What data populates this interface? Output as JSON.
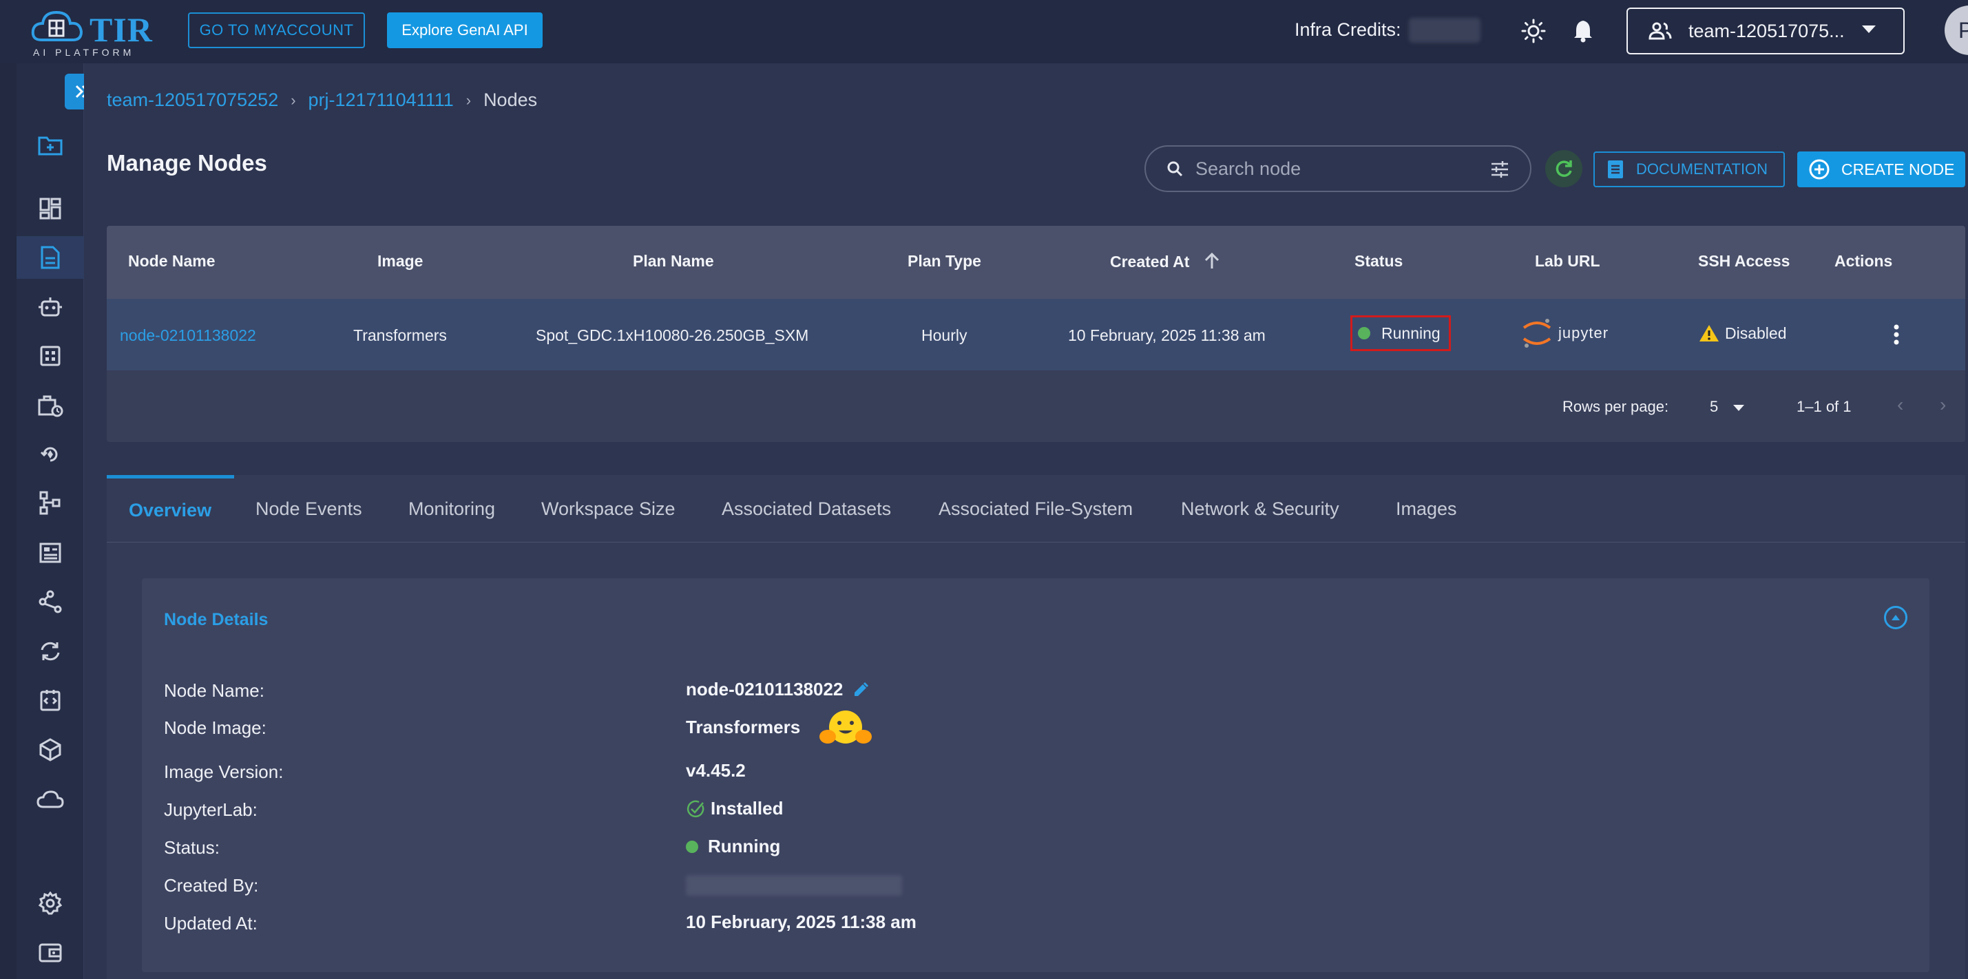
{
  "topbar": {
    "logo_text": "TIR",
    "logo_sub": "AI PLATFORM",
    "my_account": "GO TO MYACCOUNT",
    "genai": "Explore GenAI API",
    "credits_label": "Infra Credits:",
    "team_name": "team-120517075...",
    "avatar_letter": "P"
  },
  "breadcrumb": {
    "team": "team-120517075252",
    "project": "prj-121711041111",
    "current": "Nodes"
  },
  "page": {
    "title": "Manage Nodes",
    "search_placeholder": "Search node",
    "documentation": "DOCUMENTATION",
    "create_node": "CREATE NODE"
  },
  "table": {
    "headers": {
      "node_name": "Node Name",
      "image": "Image",
      "plan_name": "Plan Name",
      "plan_type": "Plan Type",
      "created_at": "Created At",
      "status": "Status",
      "lab_url": "Lab URL",
      "ssh_access": "SSH Access",
      "actions": "Actions"
    },
    "rows": [
      {
        "node_name": "node-02101138022",
        "image": "Transformers",
        "plan_name": "Spot_GDC.1xH10080-26.250GB_SXM",
        "plan_type": "Hourly",
        "created_at": "10 February, 2025 11:38 am",
        "status": "Running",
        "lab_url": "jupyter",
        "ssh_access": "Disabled"
      }
    ],
    "rows_per_page_label": "Rows per page:",
    "rows_per_page": "5",
    "range": "1–1 of 1"
  },
  "tabs": [
    {
      "label": "Overview"
    },
    {
      "label": "Node Events"
    },
    {
      "label": "Monitoring"
    },
    {
      "label": "Workspace Size"
    },
    {
      "label": "Associated Datasets"
    },
    {
      "label": "Associated File-System"
    },
    {
      "label": "Network & Security"
    },
    {
      "label": "Images"
    }
  ],
  "details": {
    "title": "Node Details",
    "labels": {
      "node_name": "Node Name:",
      "node_image": "Node Image:",
      "image_version": "Image Version:",
      "jupyterlab": "JupyterLab:",
      "status": "Status:",
      "created_by": "Created By:",
      "updated_at": "Updated At:"
    },
    "values": {
      "node_name": "node-02101138022",
      "node_image": "Transformers",
      "image_version": "v4.45.2",
      "jupyterlab": "Installed",
      "status": "Running",
      "updated_at": "10 February, 2025 11:38 am"
    }
  },
  "colors": {
    "accent": "#1598e2",
    "running": "#58b35c",
    "warning": "#f5c518",
    "highlight_border": "#d21b1b"
  },
  "icons": {
    "sidebar": [
      "folder-add-icon",
      "dashboard-icon",
      "document-icon",
      "robot-icon",
      "grid-icon",
      "briefcase-clock-icon",
      "rocket-icon",
      "pipeline-icon",
      "table-icon",
      "share-icon",
      "sync-icon",
      "code-icon",
      "cube-icon",
      "cloud-icon",
      "settings-icon",
      "wallet-icon"
    ]
  }
}
